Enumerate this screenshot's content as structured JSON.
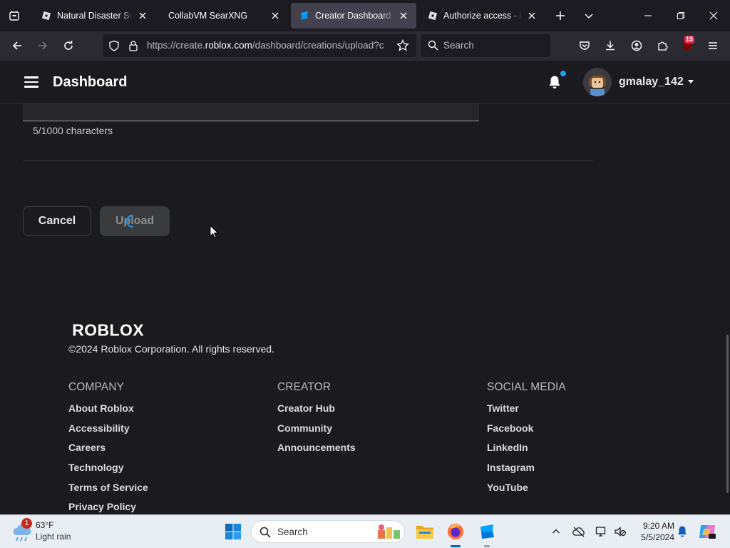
{
  "browser": {
    "tabs": [
      {
        "title": "Natural Disaster Survival",
        "active": false
      },
      {
        "title": "CollabVM SearXNG",
        "active": false
      },
      {
        "title": "Creator Dashboard",
        "active": true
      },
      {
        "title": "Authorize access - Roblox",
        "active": false
      }
    ],
    "url_prefix": "https://create.",
    "url_domain": "roblox.com",
    "url_path": "/dashboard/creations/upload?c",
    "search_placeholder": "Search",
    "extension_badge": "15"
  },
  "header": {
    "title": "Dashboard",
    "username": "gmalay_142"
  },
  "form": {
    "char_count": "5/1000 characters",
    "cancel_label": "Cancel",
    "upload_label": "Upload"
  },
  "footer": {
    "logo_text": "ROBLOX",
    "copyright": "©2024 Roblox Corporation. All rights reserved.",
    "columns": [
      {
        "heading": "COMPANY",
        "links": [
          "About Roblox",
          "Accessibility",
          "Careers",
          "Technology",
          "Terms of Service",
          "Privacy Policy"
        ]
      },
      {
        "heading": "CREATOR",
        "links": [
          "Creator Hub",
          "Community",
          "Announcements"
        ]
      },
      {
        "heading": "SOCIAL MEDIA",
        "links": [
          "Twitter",
          "Facebook",
          "LinkedIn",
          "Instagram",
          "YouTube"
        ]
      }
    ]
  },
  "taskbar": {
    "weather_temp": "63°F",
    "weather_condition": "Light rain",
    "weather_badge": "1",
    "search_placeholder": "Search",
    "time": "9:20 AM",
    "date": "5/5/2024"
  },
  "colors": {
    "page_bg": "#1b1b1f",
    "accent_blue": "#1da1f2",
    "taskbar_bg": "#e9eef5"
  }
}
